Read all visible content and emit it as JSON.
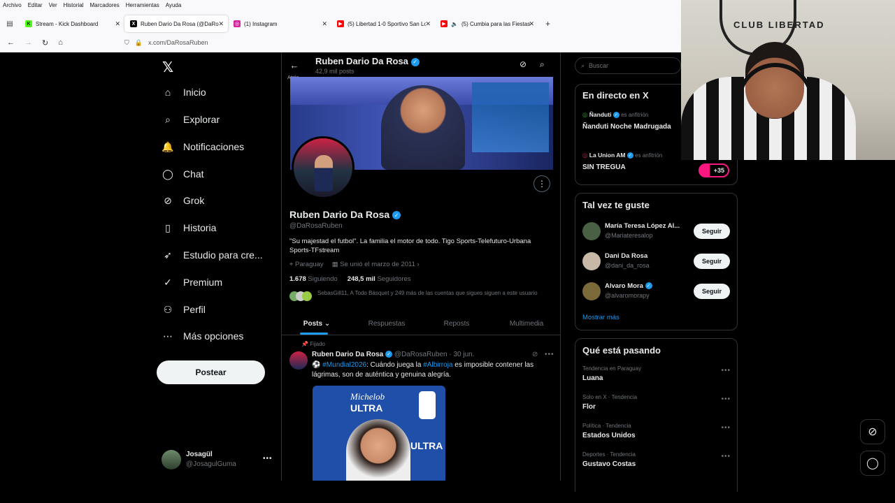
{
  "browser": {
    "menu": [
      "Archivo",
      "Editar",
      "Ver",
      "Historial",
      "Marcadores",
      "Herramientas",
      "Ayuda"
    ],
    "tabs": [
      {
        "title": "Stream - Kick Dashboard",
        "icon": "kick-icon",
        "color": "#53fc18",
        "fg": "#000",
        "glyph": "K"
      },
      {
        "title": "Ruben Dario Da Rosa (@DaRos",
        "icon": "x-icon",
        "color": "#000",
        "fg": "#fff",
        "glyph": "X"
      },
      {
        "title": "(1) Instagram",
        "icon": "instagram-icon",
        "color": "#d6249f",
        "fg": "#fff",
        "glyph": "◎"
      },
      {
        "title": "(5) Libertad 1-0 Sportivo San Lo",
        "icon": "youtube-icon",
        "color": "#ff0000",
        "fg": "#fff",
        "glyph": "▶"
      },
      {
        "title": "(5) Cumbia para las Fiestas",
        "icon": "youtube-icon",
        "color": "#ff0000",
        "fg": "#fff",
        "glyph": "▶"
      }
    ],
    "url": "x.com/DaRosaRuben"
  },
  "nav": {
    "items": [
      {
        "label": "Inicio",
        "icon": "home-icon"
      },
      {
        "label": "Explorar",
        "icon": "search-icon"
      },
      {
        "label": "Notificaciones",
        "icon": "bell-icon"
      },
      {
        "label": "Chat",
        "icon": "chat-icon"
      },
      {
        "label": "Grok",
        "icon": "grok-icon"
      },
      {
        "label": "Historia",
        "icon": "bookmark-icon"
      },
      {
        "label": "Estudio para cre...",
        "icon": "rocket-icon"
      },
      {
        "label": "Premium",
        "icon": "premium-icon"
      },
      {
        "label": "Perfil",
        "icon": "person-icon"
      },
      {
        "label": "Más opciones",
        "icon": "more-circle-icon"
      }
    ],
    "post_label": "Postear",
    "account": {
      "name": "Josagül",
      "handle": "@JosagulGuma"
    }
  },
  "profile": {
    "top_name": "Ruben Dario Da Rosa",
    "posts_count": "42,9 mil posts",
    "back_tooltip": "Atrás",
    "name": "Ruben Dario Da Rosa",
    "handle": "@DaRosaRuben",
    "bio": "\"Su majestad el futbol\". La familia el motor de todo. Tigo Sports-Telefuturo-Urbana Sports-TFstream",
    "location": "Paraguay",
    "joined": "Se unió el marzo de 2011",
    "following_count": "1.678",
    "following_label": "Siguiendo",
    "followers_count": "248,5 mil",
    "followers_label": "Seguidores",
    "followed_by": "SebasGill11, A Todo Básquet y 249 más de las cuentas que sigues siguen a este usuario",
    "tabs": [
      "Posts",
      "Respuestas",
      "Reposts",
      "Multimedia"
    ]
  },
  "tweet": {
    "pinned": "Fijado",
    "name": "Ruben Dario Da Rosa",
    "meta": "@DaRosaRuben · 30 jun.",
    "text_prefix": "⚽ ",
    "hashtag1": "#Mundial2026",
    "text_mid": ": Cuándo juega la ",
    "hashtag2": "#Albirroja",
    "text_end": " es imposible contener las lágrimas, son de auténtica y genuina alegría.",
    "media_text1": "Michelob",
    "media_text2": "ULTRA"
  },
  "right": {
    "search_placeholder": "Buscar",
    "live_title": "En directo en X",
    "live": [
      {
        "name": "Ñanduti",
        "role": "es anfitrión",
        "title": "Ñanduti Noche Madrugada"
      },
      {
        "name": "La Union AM",
        "role": "es anfitrión",
        "title": "SIN TREGUA"
      }
    ],
    "live_more": "+35",
    "suggest_title": "Tal vez te guste",
    "suggest": [
      {
        "name": "María Teresa López Al...",
        "handle": "@Mariateresalop",
        "button": "Seguir"
      },
      {
        "name": "Dani Da Rosa",
        "handle": "@dani_da_rosa",
        "button": "Seguir"
      },
      {
        "name": "Alvaro Mora",
        "handle": "@alvaromorapy",
        "button": "Seguir"
      }
    ],
    "show_more": "Mostrar más",
    "trends_title": "Qué está pasando",
    "trends": [
      {
        "context": "Tendencia en Paraguay",
        "name": "Luana"
      },
      {
        "context": "Solo en X · Tendencia",
        "name": "Flor"
      },
      {
        "context": "Política · Tendencia",
        "name": "Estados Unidos"
      },
      {
        "context": "Deportes · Tendencia",
        "name": "Gustavo Costas"
      }
    ]
  },
  "webcam": {
    "text": "CLUB LIBERTAD"
  }
}
